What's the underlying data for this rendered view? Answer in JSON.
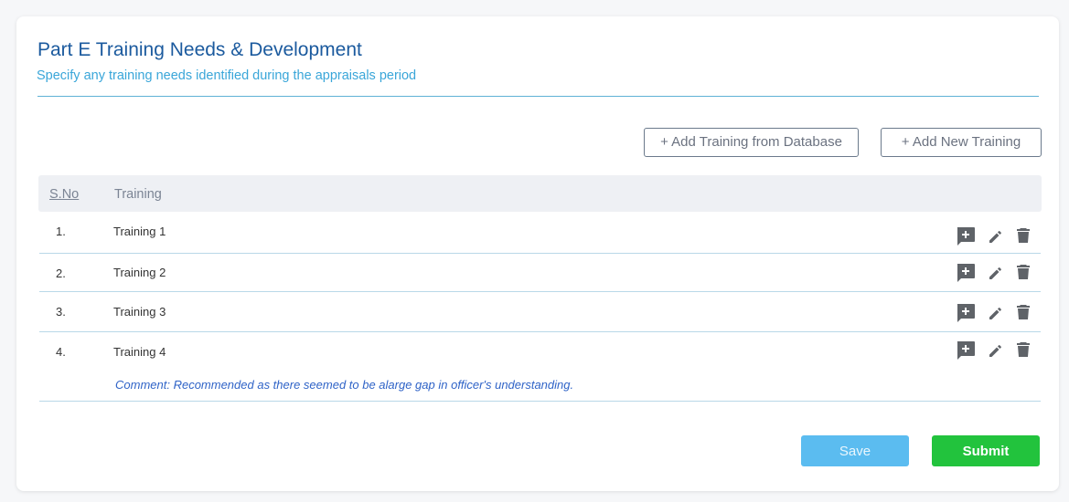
{
  "section": {
    "title": "Part E Training Needs & Development",
    "subtitle": "Specify any training needs identified during the appraisals period"
  },
  "toolbar": {
    "add_from_db_label": "+ Add Training from Database",
    "add_new_label": "+ Add New Training"
  },
  "table": {
    "columns": [
      "S.No",
      "Training"
    ],
    "rows": [
      {
        "sno": "1.",
        "training": "Training 1",
        "comment": ""
      },
      {
        "sno": "2.",
        "training": "Training 2",
        "comment": ""
      },
      {
        "sno": "3.",
        "training": "Training 3",
        "comment": ""
      },
      {
        "sno": "4.",
        "training": "Training 4",
        "comment": "Comment: Recommended as there seemed to be alarge gap in officer's understanding."
      }
    ],
    "row_action_icons": [
      "add-comment-icon",
      "pencil-icon",
      "trash-icon"
    ]
  },
  "footer": {
    "save_label": "Save",
    "submit_label": "Submit"
  },
  "colors": {
    "title": "#1b5a9e",
    "subtitle": "#3aa6d9",
    "save": "#5bbcf0",
    "submit": "#22c33d",
    "comment": "#2f63c7"
  }
}
